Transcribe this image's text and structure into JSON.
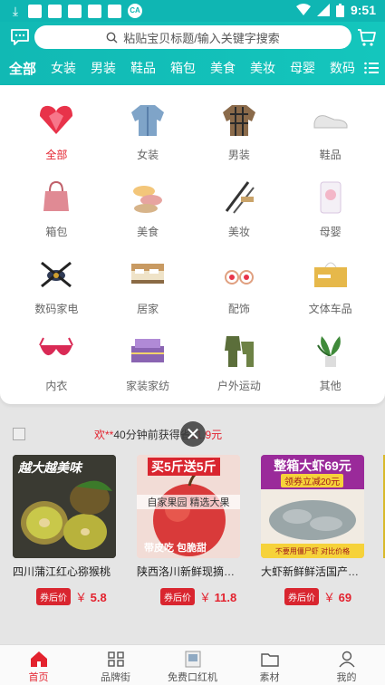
{
  "status_bar": {
    "time": "9:51",
    "left_badge": "CA"
  },
  "header": {
    "search_placeholder": "粘贴宝贝标题/输入关键字搜索",
    "categories": [
      "全部",
      "女装",
      "男装",
      "鞋品",
      "箱包",
      "美食",
      "美妆",
      "母婴",
      "数码"
    ],
    "active_category_index": 0
  },
  "panel": {
    "items": [
      {
        "label": "全部",
        "icon": "heart-gem-icon"
      },
      {
        "label": "女装",
        "icon": "denim-jacket-icon"
      },
      {
        "label": "男装",
        "icon": "plaid-shirt-icon"
      },
      {
        "label": "鞋品",
        "icon": "sneaker-icon"
      },
      {
        "label": "箱包",
        "icon": "handbag-icon"
      },
      {
        "label": "美食",
        "icon": "macaron-icon"
      },
      {
        "label": "美妆",
        "icon": "makeup-brush-icon"
      },
      {
        "label": "母婴",
        "icon": "baby-product-icon"
      },
      {
        "label": "数码家电",
        "icon": "drone-icon"
      },
      {
        "label": "居家",
        "icon": "bed-icon"
      },
      {
        "label": "配饰",
        "icon": "earrings-icon"
      },
      {
        "label": "文体车品",
        "icon": "tissue-box-icon"
      },
      {
        "label": "内衣",
        "icon": "bra-icon"
      },
      {
        "label": "家装家纺",
        "icon": "bedding-icon"
      },
      {
        "label": "户外运动",
        "icon": "outdoor-suit-icon"
      },
      {
        "label": "其他",
        "icon": "potted-plant-icon"
      }
    ],
    "active_index": 0
  },
  "ticker": {
    "name": "欢**",
    "text": " 40分钟前获得省",
    "amount": "11.9元"
  },
  "products": [
    {
      "banner": "越大越美味",
      "title": "四川蒲江红心猕猴桃",
      "tag": "券后价",
      "currency": "￥",
      "price": "5.8"
    },
    {
      "banner": "买5斤送5斤",
      "banner2": "自家果园 精选大果",
      "banner3": "带皮吃 包脆甜",
      "title": "陕西洛川新鲜现摘苹果",
      "tag": "券后价",
      "currency": "￥",
      "price": "11.8"
    },
    {
      "banner": "整箱大虾69元",
      "banner2": "领券立减20元",
      "banner3": "不要用僵尸虾 对比价格",
      "title": "大虾新鲜鲜活国产海虾",
      "tag": "券后价",
      "currency": "￥",
      "price": "69"
    }
  ],
  "tabbar": {
    "items": [
      {
        "label": "首页",
        "icon": "home-icon"
      },
      {
        "label": "品牌街",
        "icon": "brand-grid-icon"
      },
      {
        "label": "免费口红机",
        "icon": "lipstick-icon"
      },
      {
        "label": "素材",
        "icon": "folder-icon"
      },
      {
        "label": "我的",
        "icon": "profile-icon"
      }
    ],
    "active_index": 0
  },
  "colors": {
    "brand_teal": "#11b9b4",
    "accent_red": "#e3222e"
  }
}
